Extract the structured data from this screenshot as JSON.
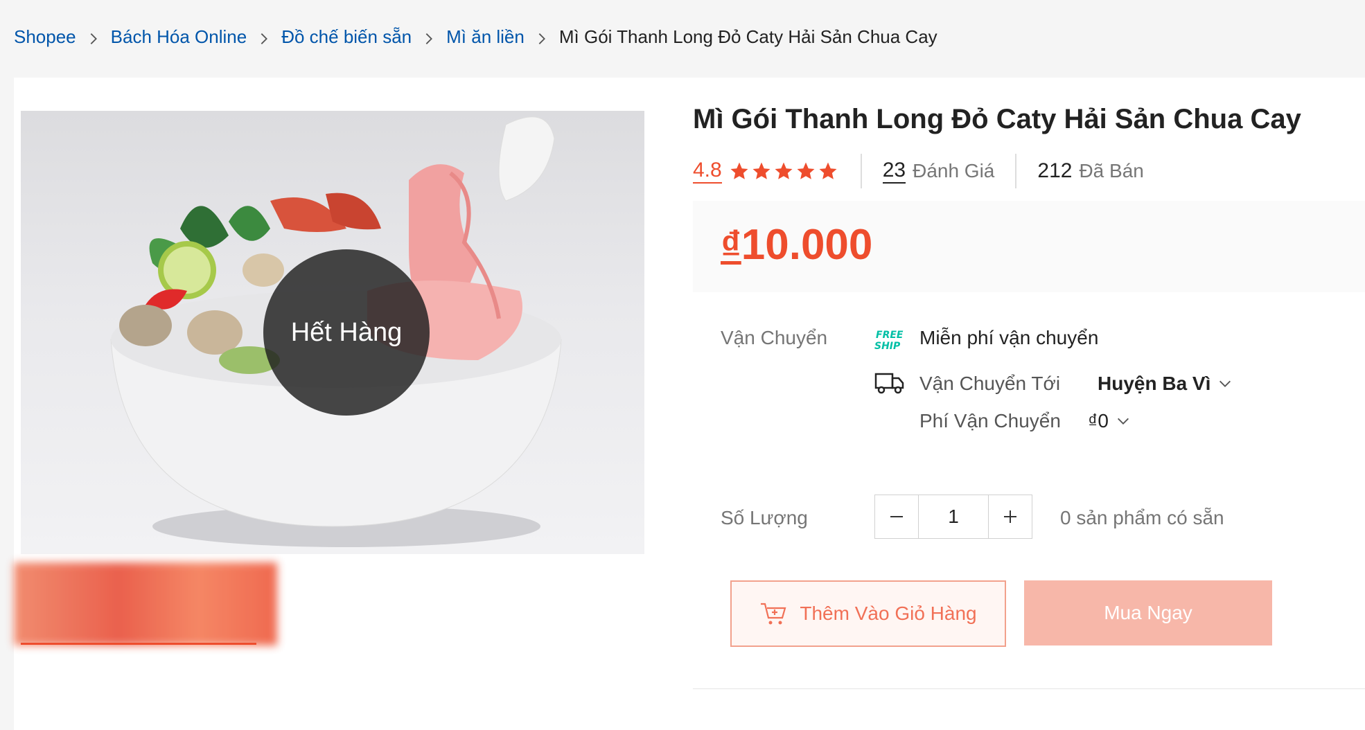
{
  "breadcrumb": {
    "items": [
      "Shopee",
      "Bách Hóa Online",
      "Đồ chế biến sẵn",
      "Mì ăn liền"
    ],
    "current": "Mì Gói Thanh Long Đỏ Caty Hải Sản Chua Cay"
  },
  "product": {
    "title": "Mì Gói Thanh Long Đỏ Caty Hải Sản Chua Cay",
    "rating": "4.8",
    "stars": 5,
    "reviews_count": "23",
    "reviews_label": "Đánh Giá",
    "sold_count": "212",
    "sold_label": "Đã Bán",
    "price": "10.000",
    "currency": "₫",
    "soldout_label": "Hết Hàng"
  },
  "shipping": {
    "label": "Vận Chuyển",
    "free_badge": [
      "FREE",
      "SHIP"
    ],
    "free_text": "Miễn phí vận chuyển",
    "to_label": "Vận Chuyển Tới",
    "to_value": "Huyện Ba Vì",
    "fee_label": "Phí Vận Chuyển",
    "fee_value": "₫0"
  },
  "quantity": {
    "label": "Số Lượng",
    "value": "1",
    "available": "0 sản phẩm có sẵn"
  },
  "actions": {
    "add_to_cart": "Thêm Vào Giỏ Hàng",
    "buy_now": "Mua Ngay"
  },
  "colors": {
    "accent": "#ee4d2d",
    "link": "#0055aa",
    "free_ship": "#00bfa5"
  }
}
